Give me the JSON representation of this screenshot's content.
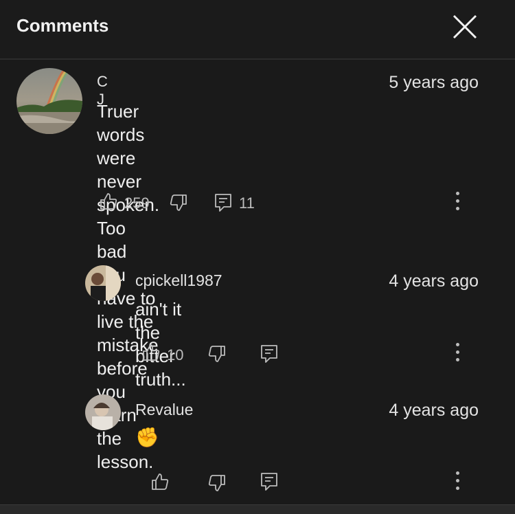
{
  "header": {
    "title": "Comments"
  },
  "comments": [
    {
      "author": "C J",
      "time": "5 years ago",
      "text_lines": [
        "Truer words were never spoken. Too bad you",
        "have to live the mistake before you learn the",
        "lesson."
      ],
      "likes": "259",
      "replies": "11"
    },
    {
      "author": "cpickell1987",
      "time": "4 years ago",
      "text_lines": [
        "ain't it the bitter truth..."
      ],
      "likes": "10"
    },
    {
      "author": "Revalue",
      "time": "4 years ago",
      "text_lines": [
        "✊"
      ]
    }
  ],
  "colors": {
    "background": "#1a1a1a",
    "text": "#efefef",
    "secondary": "#bdbdbd"
  },
  "icons": [
    "close-icon",
    "like-icon",
    "dislike-icon",
    "reply-icon",
    "more-vertical-icon"
  ]
}
